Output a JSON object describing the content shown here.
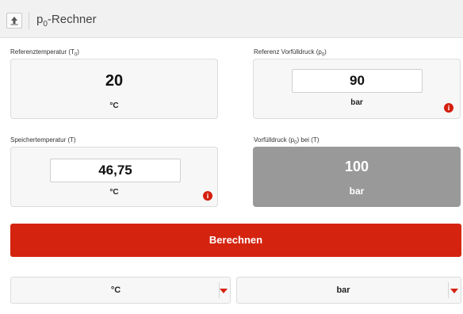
{
  "header": {
    "home_icon": "home-up-icon",
    "title_main": "p",
    "title_sub": "0",
    "title_rest": "-Rechner"
  },
  "reference_temperature": {
    "label_main": "Referenztemperatur (T",
    "label_sub": "0",
    "label_end": ")",
    "value": "20",
    "unit": "°C"
  },
  "reference_prefill_pressure": {
    "label_main": "Referenz Vorfülldruck (p",
    "label_sub": "0",
    "label_end": ")",
    "value": "90",
    "unit": "bar",
    "info_glyph": "i"
  },
  "storage_temperature": {
    "label": "Speichertemperatur (T)",
    "value": "46,75",
    "unit": "°C",
    "info_glyph": "i"
  },
  "prefill_pressure_at_t": {
    "label_main": "Vorfülldruck (p",
    "label_sub": "0",
    "label_end": ") bei (T)",
    "value": "100",
    "unit": "bar"
  },
  "actions": {
    "calculate_label": "Berechnen"
  },
  "unit_selects": {
    "temperature": "°C",
    "pressure": "bar"
  },
  "colors": {
    "accent": "#d42410",
    "result_panel": "#999999",
    "panel_bg": "#f7f7f7"
  }
}
